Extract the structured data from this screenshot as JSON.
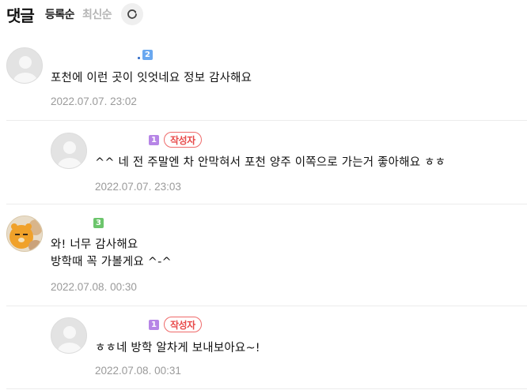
{
  "header": {
    "title": "댓글",
    "sort_registered": "등록순",
    "sort_latest": "최신순"
  },
  "comments": [
    {
      "level": "2",
      "text": "포천에 이런 곳이 잇엇네요 정보 감사해요",
      "date": "2022.07.07. 23:02"
    },
    {
      "level": "1",
      "badge": "작성자",
      "text": "^^ 네 전 주말엔 차 안막혀서 포천 양주 이쪽으로 가는거 좋아해요 ㅎㅎ",
      "date": "2022.07.07. 23:03"
    },
    {
      "level": "3",
      "text_line1": "와! 너무 감사해요",
      "text_line2": "방학때 꼭 가볼게요 ^-^",
      "date": "2022.07.08. 00:30"
    },
    {
      "level": "1",
      "badge": "작성자",
      "text": "ㅎㅎ네 방학 알차게 보내보아요~!",
      "date": "2022.07.08. 00:31"
    }
  ]
}
